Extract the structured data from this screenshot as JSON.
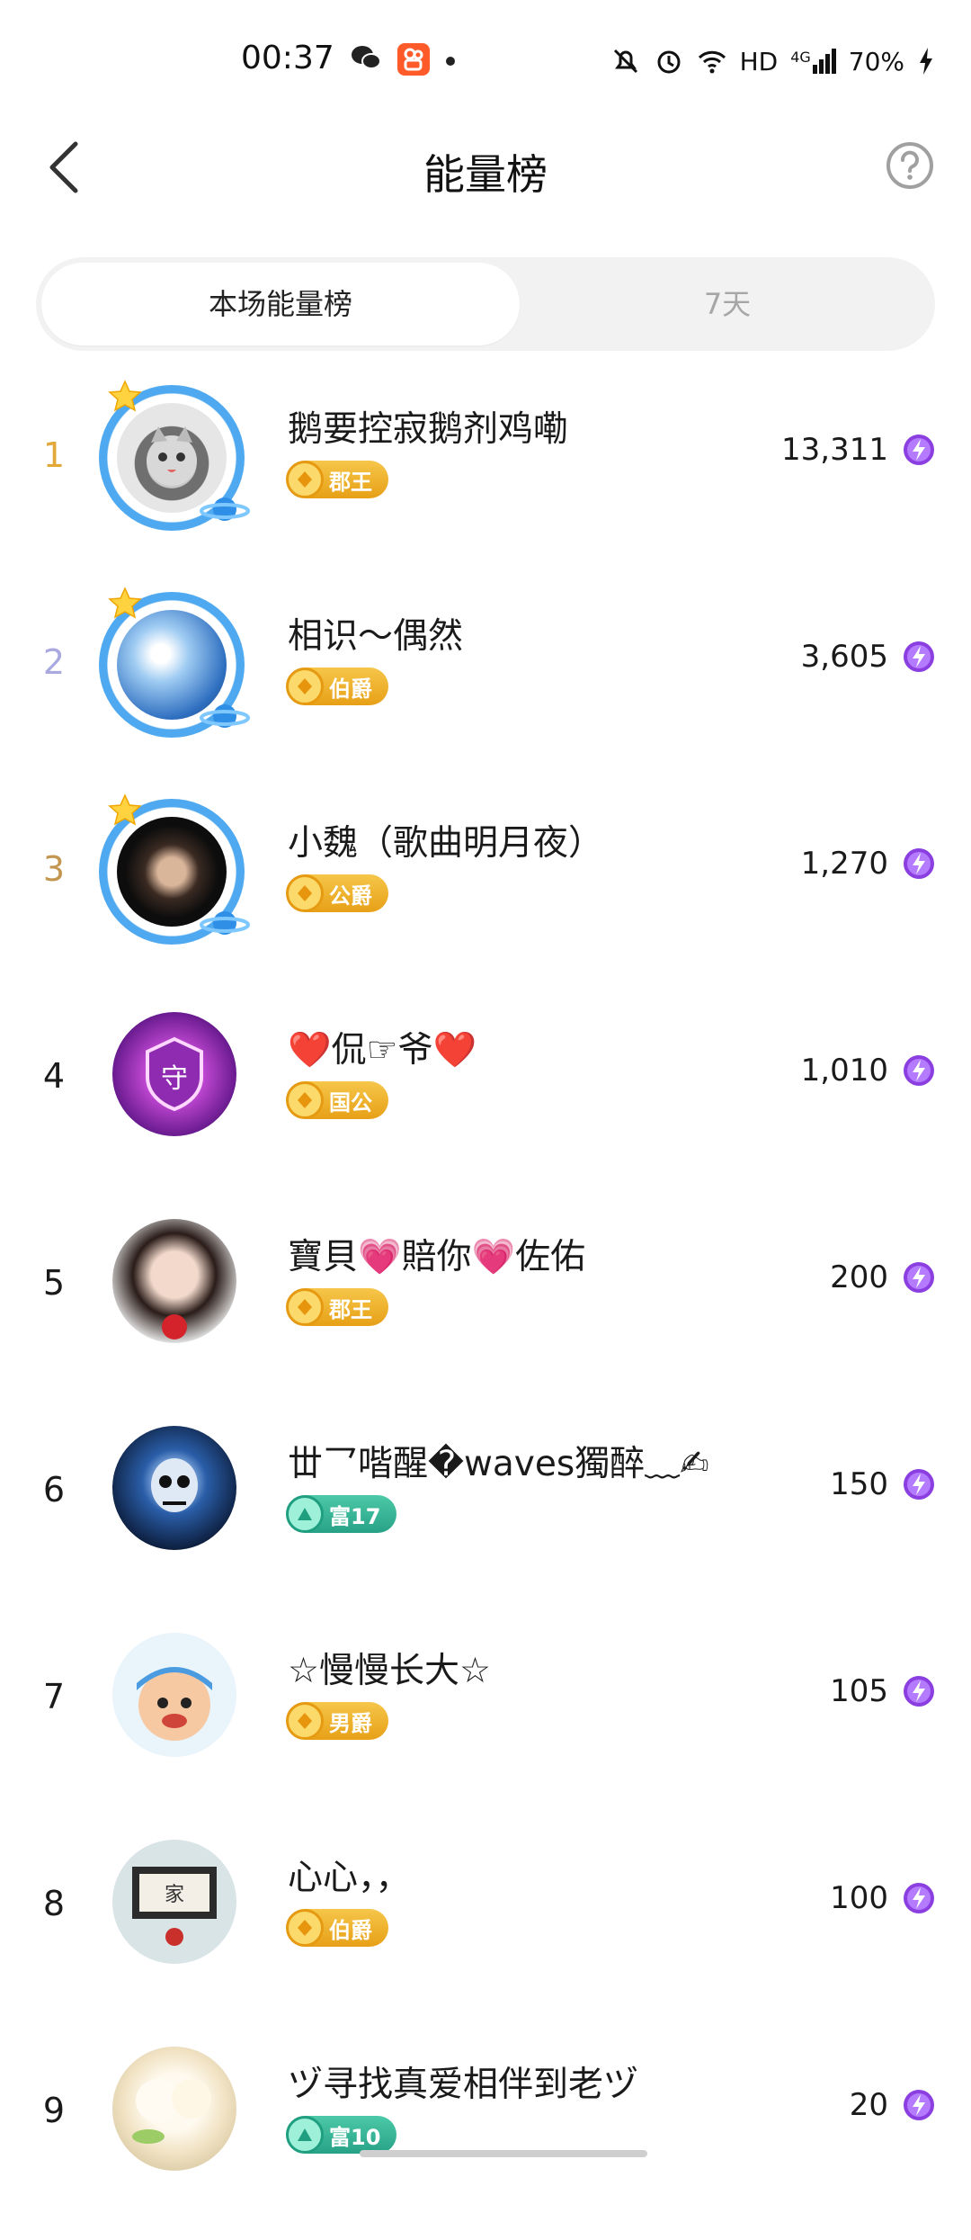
{
  "status_bar": {
    "time": "00:37",
    "network": "HD",
    "signal": "4G",
    "battery": "70%",
    "icons": [
      "wechat-icon",
      "kuaishou-icon",
      "notification-dot",
      "mute-icon",
      "alarm-icon",
      "wifi-icon",
      "signal-icon",
      "charging-icon"
    ]
  },
  "header": {
    "title": "能量榜",
    "back_icon": "chevron-left-icon",
    "help_icon": "question-circle-icon"
  },
  "tabs": [
    {
      "label": "本场能量榜",
      "active": true
    },
    {
      "label": "7天",
      "active": false
    }
  ],
  "colors": {
    "rank1": "#e2a83a",
    "rank2": "#a9a9e0",
    "rank3": "#c39650",
    "rank_default": "#1a1a1a",
    "gold_badge": "#eeaa22",
    "green_badge": "#34b394",
    "energy": "#8b3fe0"
  },
  "ranking": [
    {
      "rank": "1",
      "name": "鹅要控寂鹅剂鸡嘞",
      "badge": "郡王",
      "badge_type": "gold",
      "score": "13,311"
    },
    {
      "rank": "2",
      "name": "相识～偶然",
      "badge": "伯爵",
      "badge_type": "gold",
      "score": "3,605"
    },
    {
      "rank": "3",
      "name": "小魏（歌曲明月夜）",
      "badge": "公爵",
      "badge_type": "gold",
      "score": "1,270"
    },
    {
      "rank": "4",
      "name": "❤️侃☞爷❤️",
      "badge": "国公",
      "badge_type": "gold",
      "score": "1,010"
    },
    {
      "rank": "5",
      "name": "寶貝💗賠你💗佐佑",
      "badge": "郡王",
      "badge_type": "gold",
      "score": "200"
    },
    {
      "rank": "6",
      "name": "丗乛喈醒�waves獨醉﹏✍",
      "badge": "富17",
      "badge_type": "green",
      "score": "150"
    },
    {
      "rank": "7",
      "name": "☆慢慢长大☆",
      "badge": "男爵",
      "badge_type": "gold",
      "score": "105"
    },
    {
      "rank": "8",
      "name": "心心，，",
      "badge": "伯爵",
      "badge_type": "gold",
      "score": "100"
    },
    {
      "rank": "9",
      "name": "ヅ寻找真爱相伴到老ヅ",
      "badge": "富10",
      "badge_type": "green",
      "score": "20"
    }
  ]
}
